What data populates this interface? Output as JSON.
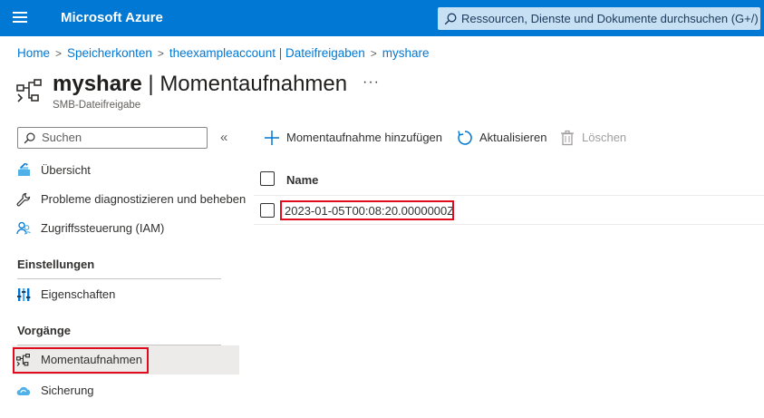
{
  "header": {
    "brand": "Microsoft Azure",
    "search_placeholder": "Ressourcen, Dienste und Dokumente durchsuchen (G+/)"
  },
  "breadcrumb": [
    "Home",
    "Speicherkonten",
    "theexampleaccount | Dateifreigaben",
    "myshare"
  ],
  "title": {
    "resource": "myshare",
    "separator": " | ",
    "blade": "Momentaufnahmen",
    "more": "···",
    "subtitle": "SMB-Dateifreigabe"
  },
  "sidebar": {
    "search_placeholder": "Suchen",
    "collapse": "«",
    "items": [
      {
        "label": "Übersicht",
        "icon": "overview-icon"
      },
      {
        "label": "Probleme diagnostizieren und beheben",
        "icon": "wrench-icon"
      },
      {
        "label": "Zugriffssteuerung (IAM)",
        "icon": "people-icon"
      }
    ],
    "sections": [
      {
        "header": "Einstellungen",
        "items": [
          {
            "label": "Eigenschaften",
            "icon": "properties-icon"
          }
        ]
      },
      {
        "header": "Vorgänge",
        "items": [
          {
            "label": "Momentaufnahmen",
            "icon": "snapshot-icon",
            "selected": true
          },
          {
            "label": "Sicherung",
            "icon": "cloud-backup-icon"
          }
        ]
      }
    ]
  },
  "toolbar": {
    "add_label": "Momentaufnahme hinzufügen",
    "refresh_label": "Aktualisieren",
    "delete_label": "Löschen"
  },
  "table": {
    "columns": [
      "Name"
    ],
    "rows": [
      [
        "2023-01-05T00:08:20.0000000Z"
      ]
    ]
  },
  "colors": {
    "accent": "#0078d4",
    "highlight": "#e00b1c",
    "selected_bg": "#edebe9"
  }
}
